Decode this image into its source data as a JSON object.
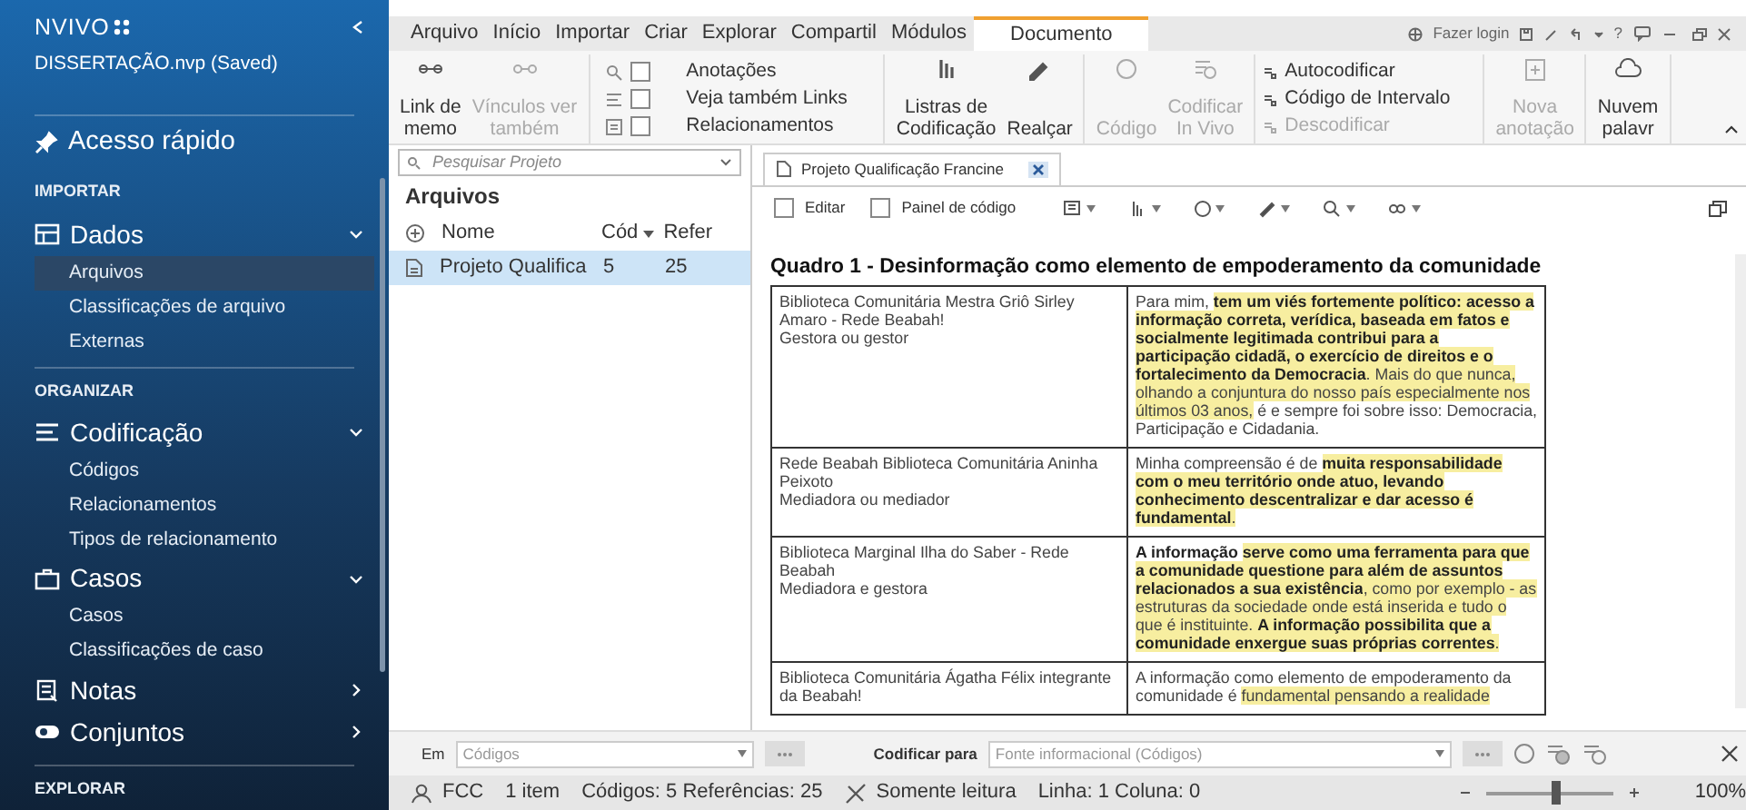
{
  "sidebar": {
    "app_name": "NVIVO",
    "project": "DISSERTAÇÃO.nvp (Saved)",
    "quick_access": "Acesso rápido",
    "sections": [
      {
        "heading": "IMPORTAR",
        "groups": [
          {
            "label": "Dados",
            "expanded": true,
            "items": [
              {
                "label": "Arquivos",
                "selected": true
              },
              {
                "label": "Classificações de arquivo",
                "selected": false
              },
              {
                "label": "Externas",
                "selected": false
              }
            ]
          }
        ]
      },
      {
        "heading": "ORGANIZAR",
        "groups": [
          {
            "label": "Codificação",
            "expanded": true,
            "items": [
              {
                "label": "Códigos",
                "selected": false
              },
              {
                "label": "Relacionamentos",
                "selected": false
              },
              {
                "label": "Tipos de relacionamento",
                "selected": false
              }
            ]
          },
          {
            "label": "Casos",
            "expanded": true,
            "items": [
              {
                "label": "Casos",
                "selected": false
              },
              {
                "label": "Classificações de caso",
                "selected": false
              }
            ]
          },
          {
            "label": "Notas",
            "expanded": false
          },
          {
            "label": "Conjuntos",
            "expanded": false
          }
        ]
      },
      {
        "heading": "EXPLORAR"
      }
    ]
  },
  "ribbon_tabs": [
    {
      "label": "Arquivo",
      "selected": false
    },
    {
      "label": "Início",
      "selected": false
    },
    {
      "label": "Importar",
      "selected": false
    },
    {
      "label": "Criar",
      "selected": false
    },
    {
      "label": "Explorar",
      "selected": false
    },
    {
      "label": "Compartil",
      "selected": false
    },
    {
      "label": "Módulos",
      "selected": false
    },
    {
      "label": "Documento",
      "selected": true
    }
  ],
  "title_bar": {
    "login": "Fazer login",
    "help": "?"
  },
  "ribbon": {
    "groups": [
      {
        "kind": "large",
        "buttons": [
          {
            "label": "Link de\nmemo",
            "disabled": false
          },
          {
            "label": "Vínculos ver\ntambém",
            "disabled": true
          }
        ]
      },
      {
        "kind": "checks",
        "items": [
          {
            "label": "Anotações",
            "checked": false
          },
          {
            "label": "Veja também Links",
            "checked": false
          },
          {
            "label": "Relacionamentos",
            "checked": false
          }
        ]
      },
      {
        "kind": "large",
        "buttons": [
          {
            "label": "Listras de\nCodificação",
            "disabled": false
          },
          {
            "label": "Realçar",
            "disabled": false
          }
        ]
      },
      {
        "kind": "large",
        "buttons": [
          {
            "label": "Código",
            "disabled": true
          },
          {
            "label": "Codificar\nIn Vivo",
            "disabled": true
          }
        ]
      },
      {
        "kind": "smalls",
        "items": [
          {
            "label": "Autocodificar",
            "disabled": false
          },
          {
            "label": "Código de Intervalo",
            "disabled": false
          },
          {
            "label": "Descodificar",
            "disabled": true
          }
        ]
      },
      {
        "kind": "large",
        "buttons": [
          {
            "label": "Nova\nanotação",
            "disabled": true
          }
        ]
      },
      {
        "kind": "large",
        "buttons": [
          {
            "label": "Nuvem\npalavr",
            "disabled": false
          }
        ]
      }
    ]
  },
  "project_list": {
    "search_placeholder": "Pesquisar Projeto",
    "title": "Arquivos",
    "columns": [
      "Nome",
      "Cód",
      "Refer"
    ],
    "rows": [
      {
        "cells": [
          "Projeto Qualifica",
          "5",
          "25"
        ],
        "selected": true
      }
    ]
  },
  "document": {
    "tabs": [
      {
        "label": "Projeto Qualificação Francine",
        "selected": true
      }
    ],
    "checks": [
      {
        "label": "Editar",
        "checked": false
      },
      {
        "label": "Painel de código",
        "checked": false
      }
    ],
    "title": "Quadro 1 - Desinformação como elemento de empoderamento da comunidade",
    "rows": [
      {
        "participant": [
          "Biblioteca Comunitária Mestra Griô Sirley Amaro - Rede Beabah!",
          "Gestora ou gestor"
        ],
        "answer": [
          {
            "text": "Para mim, ",
            "highlighted": false,
            "bold": false
          },
          {
            "text": "tem um viés fortemente político: acesso a informação correta, verídica, baseada em fatos e socialmente legitimada contribui para a participação cidadã, o exercício de direitos e o fortalecimento da Democracia",
            "highlighted": true,
            "bold": true
          },
          {
            "text": ". Mais do que nunca, olhando a conjuntura do nosso país especialmente nos últimos 03 anos,",
            "highlighted": true,
            "bold": false
          },
          {
            "text": " é e sempre foi sobre isso: Democracia, Participação e Cidadania.",
            "highlighted": false,
            "bold": false
          }
        ]
      },
      {
        "participant": [
          "Rede Beabah Biblioteca Comunitária Aninha Peixoto",
          "Mediadora ou mediador"
        ],
        "answer": [
          {
            "text": "Minha compreensão é de ",
            "highlighted": false,
            "bold": false
          },
          {
            "text": "muita responsabilidade com o meu território onde atuo, levando conhecimento descentralizar e dar acesso é fundamental",
            "highlighted": true,
            "bold": true
          },
          {
            "text": ".",
            "highlighted": true,
            "bold": false
          }
        ]
      },
      {
        "participant": [
          "Biblioteca Marginal Ilha do Saber - Rede Beabah",
          "Mediadora e gestora"
        ],
        "answer": [
          {
            "text": "A informação ",
            "highlighted": false,
            "bold": true
          },
          {
            "text": "serve como uma ferramenta para que a comunidade questione para além de assuntos relacionados a sua existência",
            "highlighted": true,
            "bold": true
          },
          {
            "text": ", como por exemplo - as estruturas da sociedade onde está inserida e tudo o que é instituinte. ",
            "highlighted": true,
            "bold": false
          },
          {
            "text": "A informação possibilita que a comunidade enxergue suas próprias correntes",
            "highlighted": true,
            "bold": true
          },
          {
            "text": ".",
            "highlighted": true,
            "bold": false
          }
        ]
      },
      {
        "participant": [
          "Biblioteca Comunitária Ágatha Félix integrante da Beabah!"
        ],
        "answer": [
          {
            "text": "A informação como elemento de empoderamento da comunidade é ",
            "highlighted": false,
            "bold": false
          },
          {
            "text": "fundamental pensando a realidade",
            "highlighted": true,
            "bold": false
          }
        ]
      }
    ]
  },
  "code_bar": {
    "in_label": "Em",
    "in_placeholder": "Códigos",
    "code_to_label": "Codificar para",
    "code_to_placeholder": "Fonte informacional (Códigos)"
  },
  "status_bar": {
    "user": "FCC",
    "items": "1 item",
    "counts": "Códigos: 5 Referências: 25",
    "mode": "Somente leitura",
    "position": "Linha: 1 Coluna: 0",
    "zoom": {
      "level": 0.55,
      "reading": "100%"
    }
  }
}
